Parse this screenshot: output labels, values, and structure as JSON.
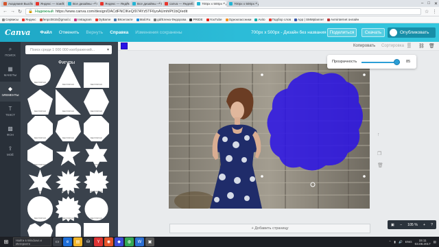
{
  "browser": {
    "tabs": [
      {
        "label": "Академия Высокоопл",
        "color": "#d5552d"
      },
      {
        "label": "Яндекс — поиск №1 в",
        "color": "#e8352c"
      },
      {
        "label": "Все дизайны — Canva",
        "color": "#24b5d3"
      },
      {
        "label": "Яндекс — Яндекс нашл",
        "color": "#e8352c"
      },
      {
        "label": "Все дизайны — Canva",
        "color": "#24b5d3"
      },
      {
        "label": "canva — Яндекс: нашл",
        "color": "#e8352c"
      },
      {
        "label": "700px x 500px – Дизай",
        "color": "#24b5d3"
      },
      {
        "label": "700px x 500px – Дизай",
        "color": "#24b5d3"
      }
    ],
    "security_label": "Надежный",
    "url": "https://www.canva.com/design/DACdFNCIKeQ/97AYz5TF6yoAUmhlPt1bQ/edit",
    "bookmarks": [
      "Сервисы",
      "Яндекс",
      "fenpc0815@gmail.c",
      "Instagram",
      "OyBame",
      "ВКонтакте",
      "Mail.Ru",
      "gd/Елена Федорова",
      "PRIDE",
      "YouTube",
      "Одноклассники",
      "Avito",
      "Подбор слов",
      "App | SMMplanner",
      "Avminternet онлайн"
    ]
  },
  "canva": {
    "logo": "Canva",
    "menu": {
      "file": "Файл",
      "undo": "Отменить",
      "redo": "Вернуть",
      "help": "Справка",
      "saved": "Изменения сохранены"
    },
    "design_title": "700px x 500px - Дизайн без названия",
    "share": "Поделиться",
    "download": "Скачать",
    "publish": "Опубликовать",
    "sidebar": [
      {
        "label": "ПОИСК",
        "glyph": "⌕",
        "icon": "search-icon"
      },
      {
        "label": "МАКЕТЫ",
        "glyph": "▦",
        "icon": "layouts-icon"
      },
      {
        "label": "ЭЛЕМЕНТЫ",
        "glyph": "◆",
        "icon": "elements-icon",
        "active": true
      },
      {
        "label": "ТЕКСТ",
        "glyph": "T",
        "icon": "text-icon"
      },
      {
        "label": "ФОН",
        "glyph": "▩",
        "icon": "background-icon"
      },
      {
        "label": "МОЁ",
        "glyph": "⇪",
        "icon": "uploads-icon"
      }
    ],
    "panel": {
      "search_placeholder": "Поиск среди 1 000 000 изображений...",
      "category": "Фигуры",
      "free_label": "БЕСПЛАТНО"
    },
    "toolbar": {
      "fill_color": "#2a12e6",
      "copy": "Копировать",
      "arrange": "Сортировка"
    },
    "transparency": {
      "label": "Прозрачность",
      "value": "85"
    },
    "add_page": "+ Добавить страницу",
    "zoom": "105 %"
  },
  "taskbar": {
    "search_placeholder": "Найти в Windows и Интернете",
    "lang": "ENG",
    "time": "15:11",
    "date": "03.08.2017"
  }
}
